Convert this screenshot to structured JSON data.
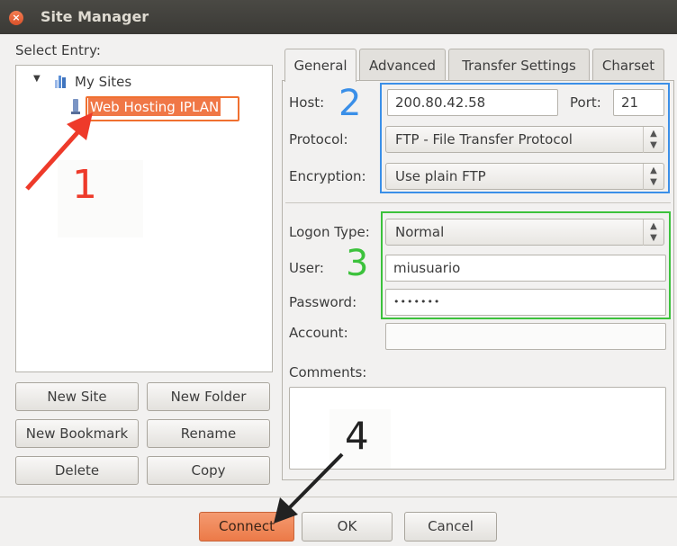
{
  "window": {
    "title": "Site Manager",
    "close_glyph": "×"
  },
  "left": {
    "select_entry_label": "Select Entry:",
    "tree": {
      "root": "My Sites",
      "selected_site": "Web Hosting IPLAN"
    },
    "buttons": {
      "new_site": "New Site",
      "new_folder": "New Folder",
      "new_bookmark": "New Bookmark",
      "rename": "Rename",
      "delete": "Delete",
      "copy": "Copy"
    }
  },
  "tabs": [
    {
      "label": "General",
      "active": true
    },
    {
      "label": "Advanced"
    },
    {
      "label": "Transfer Settings"
    },
    {
      "label": "Charset"
    }
  ],
  "general": {
    "host_label": "Host:",
    "host_value": "200.80.42.58",
    "port_label": "Port:",
    "port_value": "21",
    "protocol_label": "Protocol:",
    "protocol_value": "FTP - File Transfer Protocol",
    "encryption_label": "Encryption:",
    "encryption_value": "Use plain FTP",
    "logon_type_label": "Logon Type:",
    "logon_type_value": "Normal",
    "user_label": "User:",
    "user_value": "miusuario",
    "password_label": "Password:",
    "password_value": "•••••••",
    "account_label": "Account:",
    "account_value": "",
    "comments_label": "Comments:",
    "comments_value": ""
  },
  "footer": {
    "connect": "Connect",
    "ok": "OK",
    "cancel": "Cancel"
  },
  "annotations": {
    "step1": "1",
    "step2": "2",
    "step3": "3",
    "step4": "4"
  },
  "colors": {
    "accent": "#f07746",
    "annotation_red": "#ee3a2a",
    "annotation_blue": "#3a8fe8",
    "annotation_green": "#3cc23c",
    "annotation_black": "#222222"
  },
  "icons": {
    "close": "close-icon",
    "expander": "triangle-down-icon",
    "folder": "sites-folder-icon",
    "site": "server-icon",
    "spinner": "spinner-arrows-icon"
  }
}
